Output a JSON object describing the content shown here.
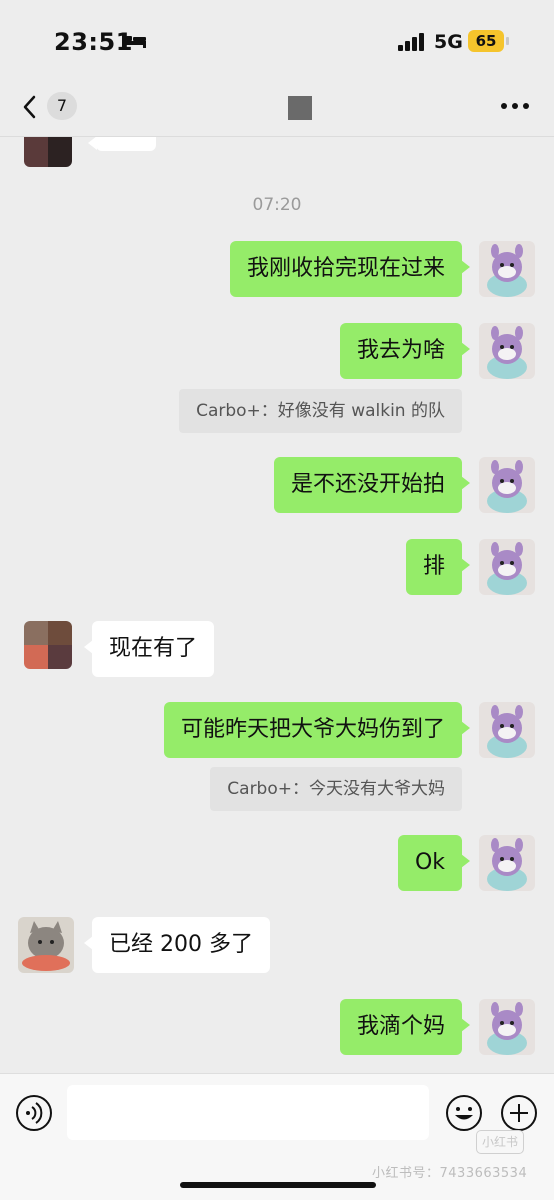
{
  "status_bar": {
    "time": "23:51",
    "network": "5G",
    "battery": "65"
  },
  "nav": {
    "unread_count": "7"
  },
  "chat": {
    "timestamp": "07:20",
    "messages": [
      {
        "text": "我刚收拾完现在过来"
      },
      {
        "text": "我去为啥"
      },
      {
        "quote": "Carbo+：好像没有 walkin 的队"
      },
      {
        "text": "是不还没开始拍"
      },
      {
        "text": "排"
      },
      {
        "text": "现在有了"
      },
      {
        "text": "可能昨天把大爷大妈伤到了"
      },
      {
        "quote": "Carbo+：今天没有大爷大妈"
      },
      {
        "text": "Ok"
      },
      {
        "text": "已经 200 多了"
      },
      {
        "text": "我滴个妈"
      }
    ]
  },
  "footer": {
    "watermark": "小红书号：7433663534",
    "watermark_logo": "小红书"
  },
  "colors": {
    "my_bubble": "#95ec69",
    "other_bubble": "#ffffff",
    "background": "#ededed"
  }
}
